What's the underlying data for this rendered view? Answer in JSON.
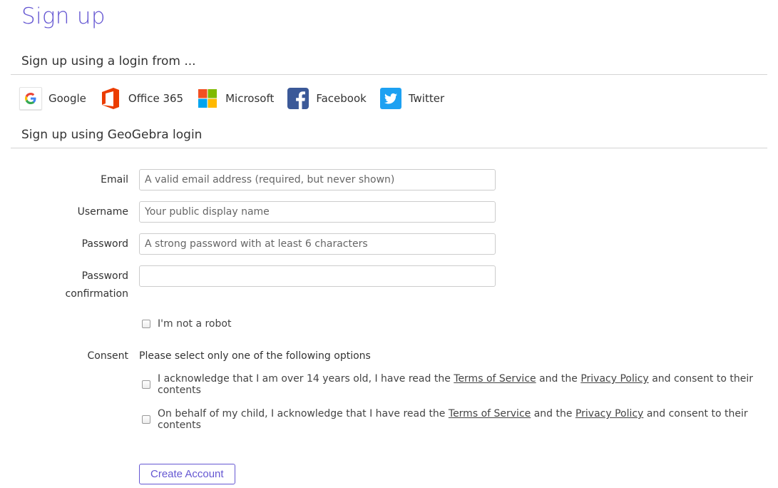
{
  "page": {
    "title": "Sign up"
  },
  "social": {
    "heading": "Sign up using a login from ...",
    "providers": [
      {
        "name": "Google",
        "icon": "google-icon"
      },
      {
        "name": "Office 365",
        "icon": "office-365-icon"
      },
      {
        "name": "Microsoft",
        "icon": "microsoft-icon"
      },
      {
        "name": "Facebook",
        "icon": "facebook-icon"
      },
      {
        "name": "Twitter",
        "icon": "twitter-icon"
      }
    ]
  },
  "geogebra": {
    "heading": "Sign up using GeoGebra login"
  },
  "form": {
    "email": {
      "label": "Email",
      "placeholder": "A valid email address (required, but never shown)",
      "value": ""
    },
    "username": {
      "label": "Username",
      "placeholder": "Your public display name",
      "value": ""
    },
    "password": {
      "label": "Password",
      "placeholder": "A strong password with at least 6 characters",
      "value": ""
    },
    "password_confirmation": {
      "label_line1": "Password",
      "label_line2": "confirmation",
      "placeholder": "",
      "value": ""
    },
    "captcha": {
      "label": "I'm not a robot",
      "checked": false
    }
  },
  "consent": {
    "label": "Consent",
    "intro": "Please select only one of the following options",
    "option1": {
      "text_before": "I acknowledge that I am over 14 years old, I have read the",
      "terms_link": "Terms of Service",
      "text_and": "and the",
      "privacy_link": "Privacy Policy",
      "text_after": "and consent to their contents",
      "checked": false
    },
    "option2": {
      "text_before": "On behalf of my child, I acknowledge that I have read the",
      "terms_link": "Terms of Service",
      "text_and": "and the",
      "privacy_link": "Privacy Policy",
      "text_after": "and consent to their contents",
      "checked": false
    }
  },
  "actions": {
    "create_account": "Create Account"
  },
  "colors": {
    "accent": "#6557d2",
    "facebook": "#3b5998",
    "twitter": "#1da1f2",
    "office": "#eb3c00"
  }
}
